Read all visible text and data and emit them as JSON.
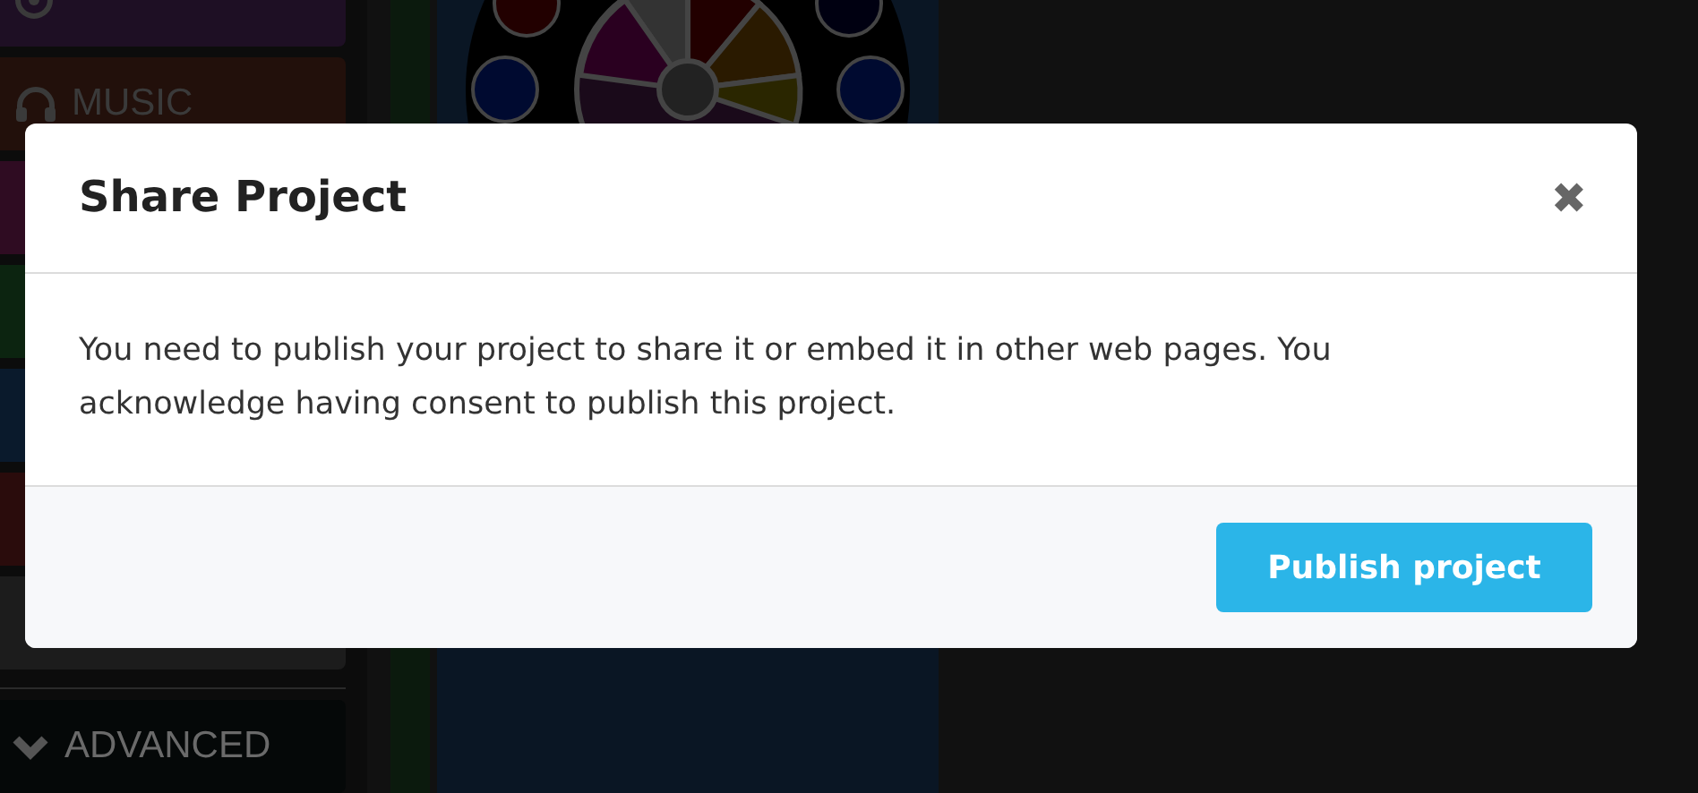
{
  "sidebar": {
    "items": [
      {
        "color": "#1e0f24",
        "kind": "target"
      },
      {
        "label": "MUSIC",
        "color": "#22100b",
        "kind": "headphones"
      },
      {
        "color": "#2f0c22"
      },
      {
        "color": "#0c2410"
      },
      {
        "color": "#0a1a2c"
      },
      {
        "color": "#2a0c0c"
      },
      {
        "color": "#1c1c1c"
      }
    ],
    "advanced": {
      "label": "ADVANCED",
      "expanded": false
    }
  },
  "dialog": {
    "title": "Share Project",
    "close": "✖",
    "message": "You need to publish your project to share it or embed it in other web pages. You acknowledge having consent to publish this project.",
    "button": "Publish project"
  }
}
